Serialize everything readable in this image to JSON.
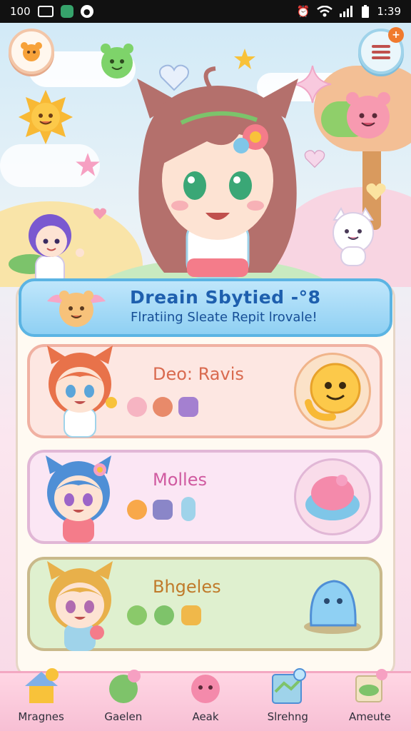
{
  "status_bar": {
    "left_text": "100",
    "time": "1:39"
  },
  "dialog": {
    "title": "Dreain Sbytied -°8",
    "subtitle": "Flratiing Sleate Repit lrovale!"
  },
  "cards": [
    {
      "label": "Deo: Ravis",
      "color": "#d96a4f"
    },
    {
      "label": "Molles",
      "color": "#d05aa0"
    },
    {
      "label": "Bhgeles",
      "color": "#c07a2a"
    }
  ],
  "nav": [
    {
      "label": "Mragnes"
    },
    {
      "label": "Gaelen"
    },
    {
      "label": "Aeak"
    },
    {
      "label": "Slrehng"
    },
    {
      "label": "Ameute"
    }
  ],
  "icons": {
    "menu_badge": "+"
  }
}
